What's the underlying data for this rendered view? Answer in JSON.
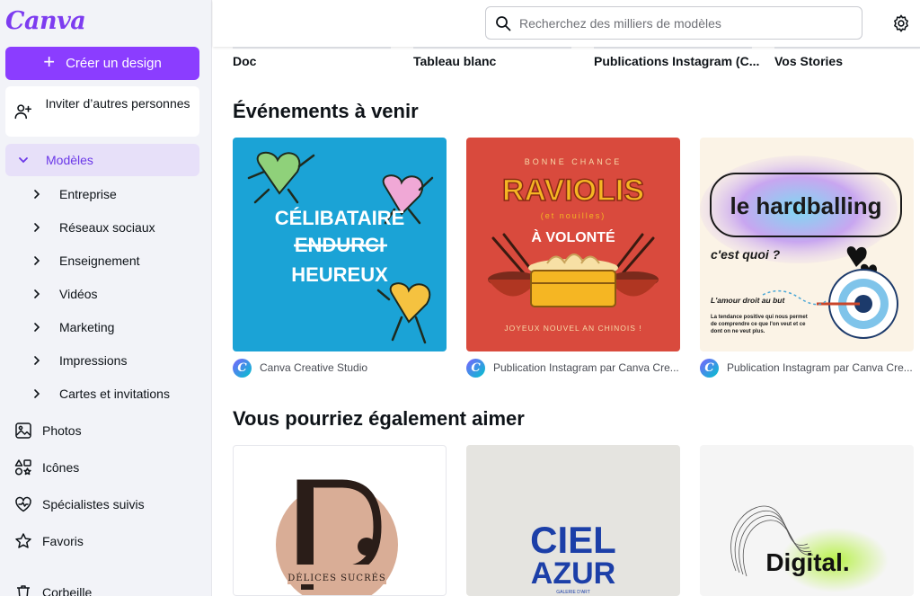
{
  "app": {
    "logo": "Canva"
  },
  "sidebar": {
    "create_label": "Créer un design",
    "invite_label": "Inviter d’autres personnes",
    "models_label": "Modèles",
    "subitems": [
      "Entreprise",
      "Réseaux sociaux",
      "Enseignement",
      "Vidéos",
      "Marketing",
      "Impressions",
      "Cartes et invitations"
    ],
    "items": [
      "Photos",
      "Icônes",
      "Spécialistes suivis",
      "Favoris",
      "Corbeille"
    ]
  },
  "search": {
    "placeholder": "Recherchez des milliers de modèles"
  },
  "categories": [
    "Doc",
    "Tableau blanc",
    "Publications Instagram (C...",
    "Vos Stories"
  ],
  "sections": {
    "events_title": "Événements à venir",
    "like_title": "Vous pourriez également aimer"
  },
  "events": [
    {
      "author": "Canva Creative Studio",
      "lines": [
        "CÉLIBATAIRE",
        "ENDURCI",
        "HEUREUX"
      ]
    },
    {
      "author": "Publication Instagram par Canva Cre...",
      "top": "BONNE CHANCE",
      "title": "RAVIOLIS",
      "sub": "(et nouilles)",
      "volonte": "À VOLONTÉ",
      "footer": "JOYEUX NOUVEL AN CHINOIS !"
    },
    {
      "author": "Publication Instagram par Canva Cre...",
      "title": "le hardballing",
      "question": "c'est quoi ?",
      "tag": "L'amour droit au but",
      "desc": "La tendance positive qui nous permet de comprendre ce que l'on veut et ce dont on ne veut plus."
    }
  ],
  "like": [
    {
      "caption": "DÉLICES SUCRÉS"
    },
    {
      "line1": "CIEL",
      "line2": "AZUR",
      "small": "GALERIE D'ART"
    },
    {
      "word": "Digital."
    }
  ],
  "colors": {
    "accent": "#8b3dff",
    "active_bg": "#e7e0f9",
    "sidebar_bg": "#f2f3f8"
  }
}
